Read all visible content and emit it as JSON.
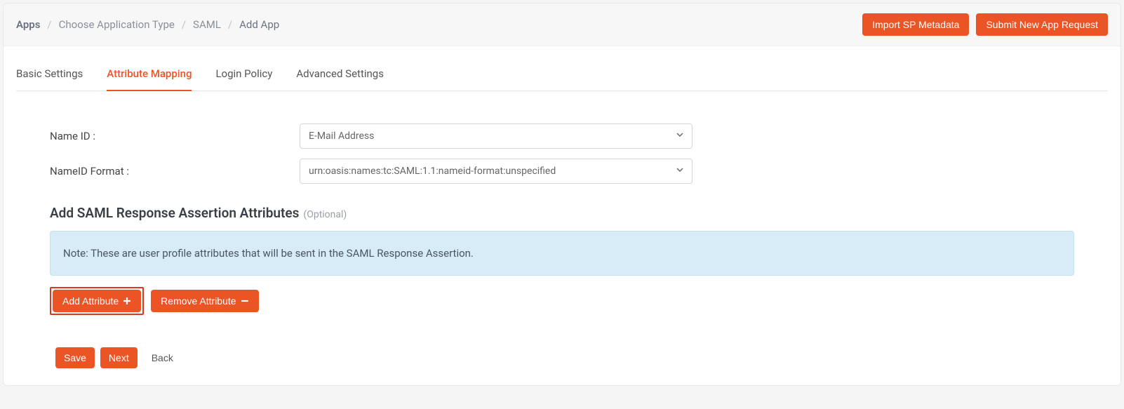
{
  "breadcrumbs": {
    "apps": "Apps",
    "choose_type": "Choose Application Type",
    "saml": "SAML",
    "add_app": "Add App"
  },
  "header_buttons": {
    "import_sp": "Import SP Metadata",
    "submit_request": "Submit New App Request"
  },
  "tabs": {
    "basic": "Basic Settings",
    "attribute": "Attribute Mapping",
    "login": "Login Policy",
    "advanced": "Advanced Settings"
  },
  "form": {
    "name_id_label": "Name ID :",
    "name_id_value": "E-Mail Address",
    "nameid_format_label": "NameID Format :",
    "nameid_format_value": "urn:oasis:names:tc:SAML:1.1:nameid-format:unspecified"
  },
  "section": {
    "title": "Add SAML Response Assertion Attributes",
    "optional": "(Optional)",
    "note": "Note: These are user profile attributes that will be sent in the SAML Response Assertion."
  },
  "attr_buttons": {
    "add": "Add Attribute",
    "remove": "Remove Attribute"
  },
  "footer": {
    "save": "Save",
    "next": "Next",
    "back": "Back"
  }
}
